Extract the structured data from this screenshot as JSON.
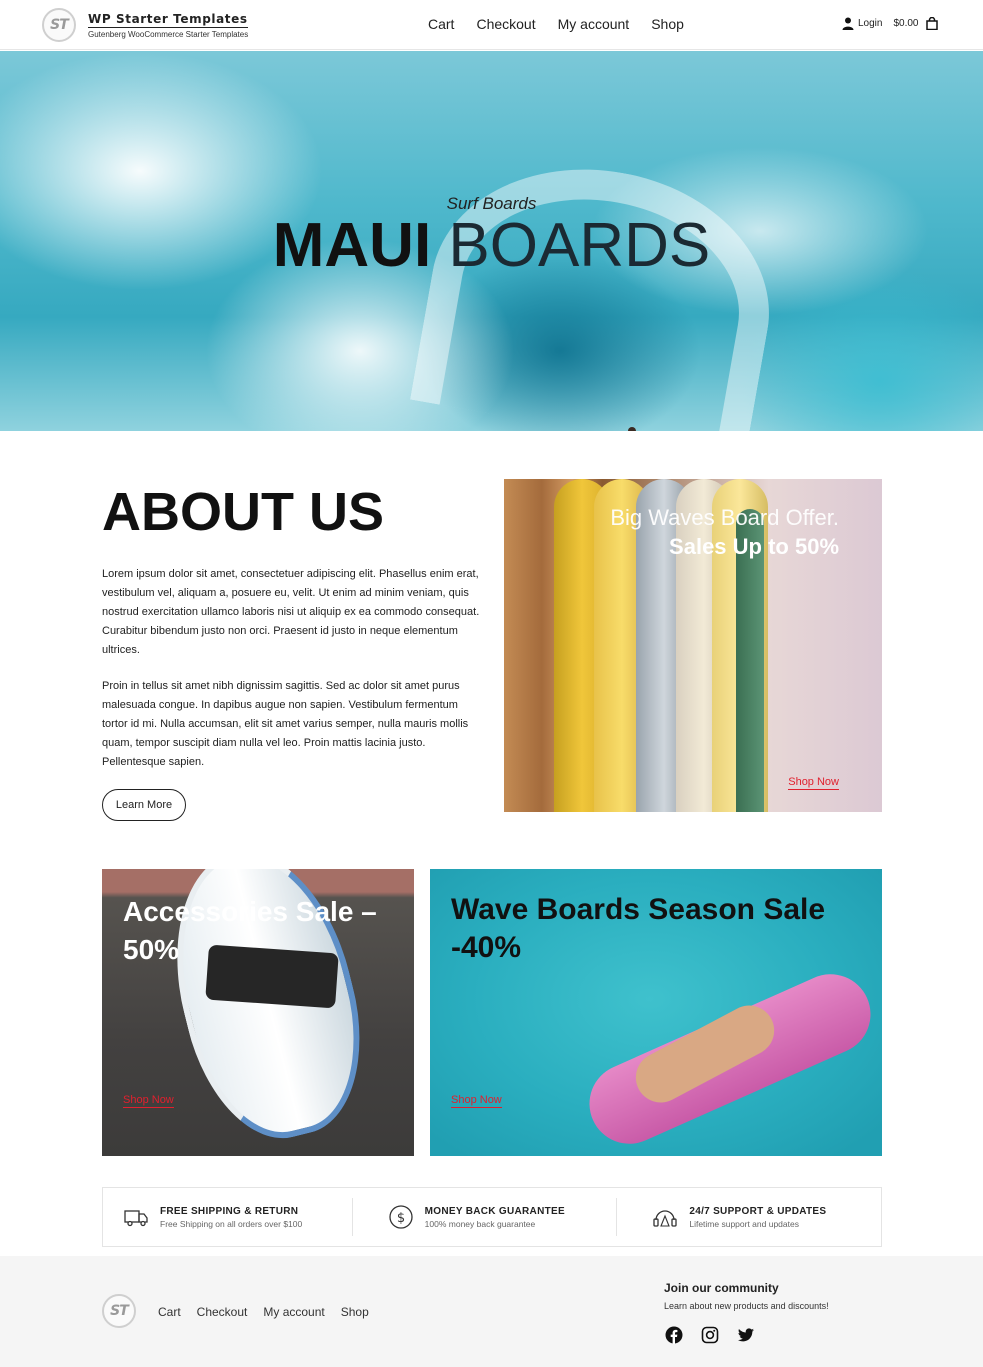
{
  "header": {
    "logo_mark": "ST",
    "site_title": "WP Starter Templates",
    "site_tagline": "Gutenberg WooCommerce Starter Templates",
    "nav": [
      "Cart",
      "Checkout",
      "My account",
      "Shop"
    ],
    "login_label": "Login",
    "cart_total": "$0.00"
  },
  "hero": {
    "subtitle": "Surf Boards",
    "title_bold": "MAUI",
    "title_light": "BOARDS"
  },
  "about": {
    "title_bold": "ABOUT",
    "title_light": "US",
    "paragraph1": "Lorem ipsum dolor sit amet, consectetuer adipiscing elit. Phasellus enim erat, vestibulum vel, aliquam a, posuere eu, velit. Ut enim ad minim veniam, quis nostrud exercitation ullamco laboris nisi ut aliquip ex ea commodo consequat. Curabitur bibendum justo non orci. Praesent id justo in neque elementum ultrices.",
    "paragraph2": "Proin in tellus sit amet nibh dignissim sagittis. Sed ac dolor sit amet purus malesuada congue. In dapibus augue non sapien. Vestibulum fermentum tortor id mi. Nulla accumsan, elit sit amet varius semper, nulla mauris mollis quam, tempor suscipit diam nulla vel leo. Proin mattis lacinia justo. Pellentesque sapien.",
    "button_label": "Learn More"
  },
  "promos": {
    "big_waves": {
      "line1": "Big Waves Board Offer.",
      "line2": "Sales Up to 50%",
      "link": "Shop Now"
    },
    "accessories": {
      "title": "Accessories Sale – 50%",
      "link": "Shop Now"
    },
    "wave_boards": {
      "title": "Wave Boards Season Sale -40%",
      "link": "Shop Now"
    }
  },
  "features": [
    {
      "icon": "truck-icon",
      "title": "FREE SHIPPING & RETURN",
      "subtitle": "Free Shipping on all orders over $100"
    },
    {
      "icon": "dollar-coin-icon",
      "title": "MONEY BACK GUARANTEE",
      "subtitle": "100% money back guarantee"
    },
    {
      "icon": "support-icon",
      "title": "24/7 SUPPORT & UPDATES",
      "subtitle": "Lifetime support and updates"
    }
  ],
  "footer": {
    "logo_mark": "ST",
    "nav": [
      "Cart",
      "Checkout",
      "My account",
      "Shop"
    ],
    "community_title": "Join our community",
    "community_subtitle": "Learn about new products and discounts!",
    "socials": [
      "facebook-icon",
      "instagram-icon",
      "twitter-icon"
    ]
  },
  "colors": {
    "accent_link": "#e0202e",
    "footer_bg": "#f5f5f5"
  }
}
